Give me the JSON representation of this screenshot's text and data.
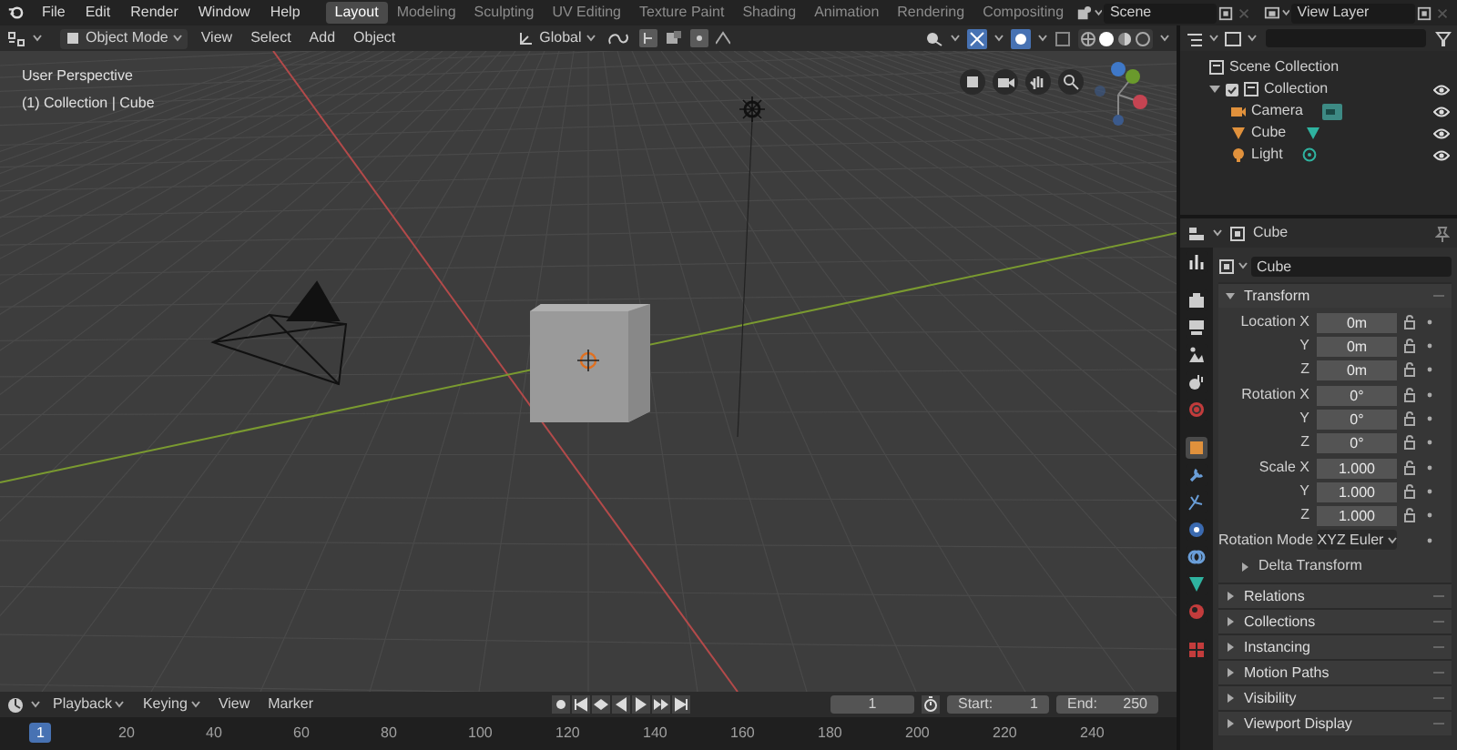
{
  "menu_bar": {
    "items": [
      "File",
      "Edit",
      "Render",
      "Window",
      "Help"
    ]
  },
  "workspace_tabs": [
    {
      "label": "Layout",
      "selected": true
    },
    {
      "label": "Modeling",
      "selected": false
    },
    {
      "label": "Sculpting",
      "selected": false
    },
    {
      "label": "UV Editing",
      "selected": false
    },
    {
      "label": "Texture Paint",
      "selected": false
    },
    {
      "label": "Shading",
      "selected": false
    },
    {
      "label": "Animation",
      "selected": false
    },
    {
      "label": "Rendering",
      "selected": false
    },
    {
      "label": "Compositing",
      "selected": false
    }
  ],
  "scene": {
    "name": "Scene"
  },
  "view_layer": {
    "name": "View Layer"
  },
  "viewport_header": {
    "mode": "Object Mode",
    "menus": [
      "View",
      "Select",
      "Add",
      "Object"
    ],
    "orientation": "Global"
  },
  "viewport": {
    "view_name": "User Perspective",
    "context": "(1) Collection | Cube"
  },
  "outliner": {
    "root": "Scene Collection",
    "tree": [
      {
        "label": "Collection",
        "kind": "collection",
        "expanded": true,
        "children": [
          {
            "label": "Camera",
            "kind": "camera"
          },
          {
            "label": "Cube",
            "kind": "mesh"
          },
          {
            "label": "Light",
            "kind": "light"
          }
        ]
      }
    ]
  },
  "properties": {
    "object_name": "Cube",
    "data_name": "Cube",
    "transform_title": "Transform",
    "rows": [
      {
        "label": "Location X",
        "value": "0m"
      },
      {
        "label": "Y",
        "value": "0m"
      },
      {
        "label": "Z",
        "value": "0m"
      },
      {
        "label": "Rotation X",
        "value": "0°"
      },
      {
        "label": "Y",
        "value": "0°"
      },
      {
        "label": "Z",
        "value": "0°"
      },
      {
        "label": "Scale X",
        "value": "1.000"
      },
      {
        "label": "Y",
        "value": "1.000"
      },
      {
        "label": "Z",
        "value": "1.000"
      }
    ],
    "rotation_mode": {
      "label": "Rotation Mode",
      "value": "XYZ Euler"
    },
    "subpanel": "Delta Transform",
    "panels": [
      "Relations",
      "Collections",
      "Instancing",
      "Motion Paths",
      "Visibility",
      "Viewport Display"
    ]
  },
  "timeline": {
    "menus": [
      "Playback",
      "Keying",
      "View",
      "Marker"
    ],
    "current_frame": "1",
    "start_label": "Start:",
    "start": "1",
    "end_label": "End:",
    "end": "250",
    "ruler": [
      {
        "label": "1",
        "selected": true
      },
      {
        "label": "20",
        "selected": false
      },
      {
        "label": "40",
        "selected": false
      },
      {
        "label": "60",
        "selected": false
      },
      {
        "label": "80",
        "selected": false
      },
      {
        "label": "100",
        "selected": false
      },
      {
        "label": "120",
        "selected": false
      },
      {
        "label": "140",
        "selected": false
      },
      {
        "label": "160",
        "selected": false
      },
      {
        "label": "180",
        "selected": false
      },
      {
        "label": "200",
        "selected": false
      },
      {
        "label": "220",
        "selected": false
      },
      {
        "label": "240",
        "selected": false
      }
    ]
  }
}
